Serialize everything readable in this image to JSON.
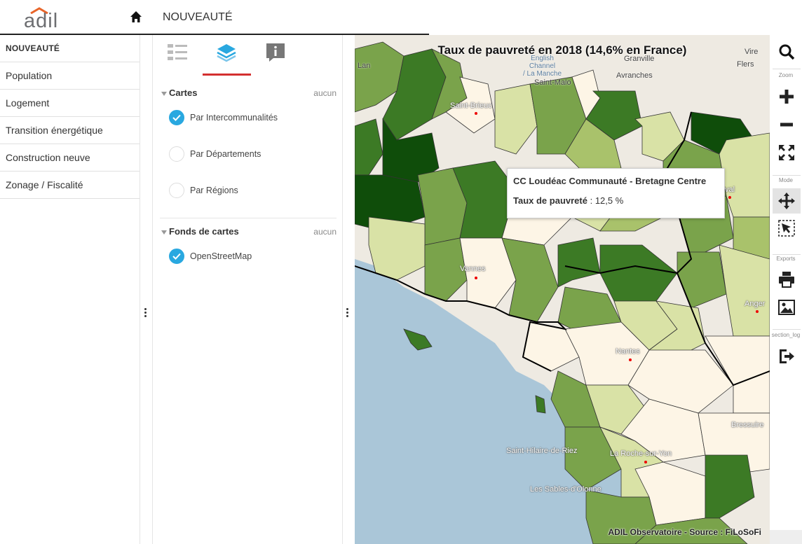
{
  "header": {
    "logo_text": "adil",
    "title": "NOUVEAUTÉ"
  },
  "nav": {
    "items": [
      {
        "label": "NOUVEAUTÉ",
        "active": true
      },
      {
        "label": "Population"
      },
      {
        "label": "Logement"
      },
      {
        "label": "Transition énergétique"
      },
      {
        "label": "Construction neuve"
      },
      {
        "label": "Zonage / Fiscalité"
      }
    ]
  },
  "panel": {
    "tabs": [
      "legend-icon",
      "layers-icon",
      "info-icon"
    ],
    "active_tab": "layers",
    "cartes": {
      "heading": "Cartes",
      "none_label": "aucun",
      "options": [
        {
          "label": "Par Intercommunalités",
          "checked": true
        },
        {
          "label": "Par Départements",
          "checked": false
        },
        {
          "label": "Par Régions",
          "checked": false
        }
      ]
    },
    "fonds": {
      "heading": "Fonds de cartes",
      "none_label": "aucun",
      "options": [
        {
          "label": "OpenStreetMap",
          "checked": true
        }
      ]
    }
  },
  "map": {
    "title": "Taux de pauvreté en 2018 (14,6% en France)",
    "tooltip": {
      "title": "CC Loudéac Communauté - Bretagne Centre",
      "key": "Taux de pauvreté",
      "sep": " : ",
      "value": "12,5 %"
    },
    "source": "ADIL Observatoire - Source : FiLoSoFi",
    "places": [
      {
        "name": "Saint-Brieuc"
      },
      {
        "name": "Vannes"
      },
      {
        "name": "Nantes"
      },
      {
        "name": "La Roche-sur-Yon"
      },
      {
        "name": "Laval"
      },
      {
        "name": "Angers"
      },
      {
        "name": "Saint-Malo"
      },
      {
        "name": "Avranches"
      },
      {
        "name": "Granville"
      },
      {
        "name": "Flers"
      },
      {
        "name": "Vire"
      },
      {
        "name": "Lannion"
      },
      {
        "name": "English Channel / La Manche"
      },
      {
        "name": "Bressuire"
      },
      {
        "name": "Saint-Hilaire-de-Riez"
      },
      {
        "name": "Les Sables-d'Olonne"
      }
    ]
  },
  "toolbar": {
    "zoom_label": "Zoom",
    "mode_label": "Mode",
    "exports_label": "Exports",
    "section_label": "section_log"
  },
  "colors": {
    "accent_red": "#d32f2f",
    "check_blue": "#29a8e0",
    "sea": "#aac6d8",
    "choropleth": [
      "#fdf5e6",
      "#d9e2a6",
      "#a9c26b",
      "#7aa34b",
      "#3c7a25",
      "#0f4d0a"
    ]
  }
}
